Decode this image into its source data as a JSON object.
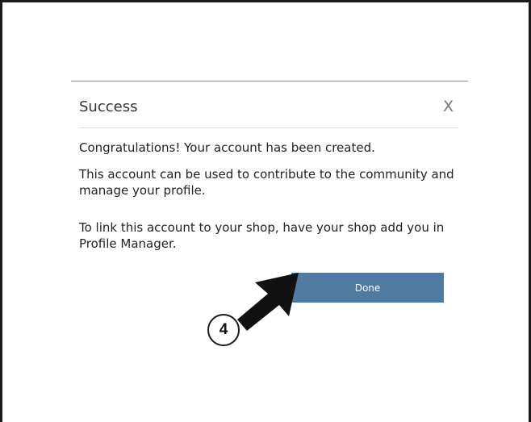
{
  "dialog": {
    "title": "Success",
    "close_label": "X",
    "messages": [
      "Congratulations! Your account has been created.",
      "This account can be used to contribute to the community and manage your profile.",
      "To link this account to your shop, have your shop add you in Profile Manager."
    ],
    "done_label": "Done"
  },
  "annotation": {
    "step_number": "4",
    "arrow_icon": "pointer-arrow-icon"
  },
  "colors": {
    "button": "#4f7aa2",
    "frame": "#1a1a1a"
  }
}
